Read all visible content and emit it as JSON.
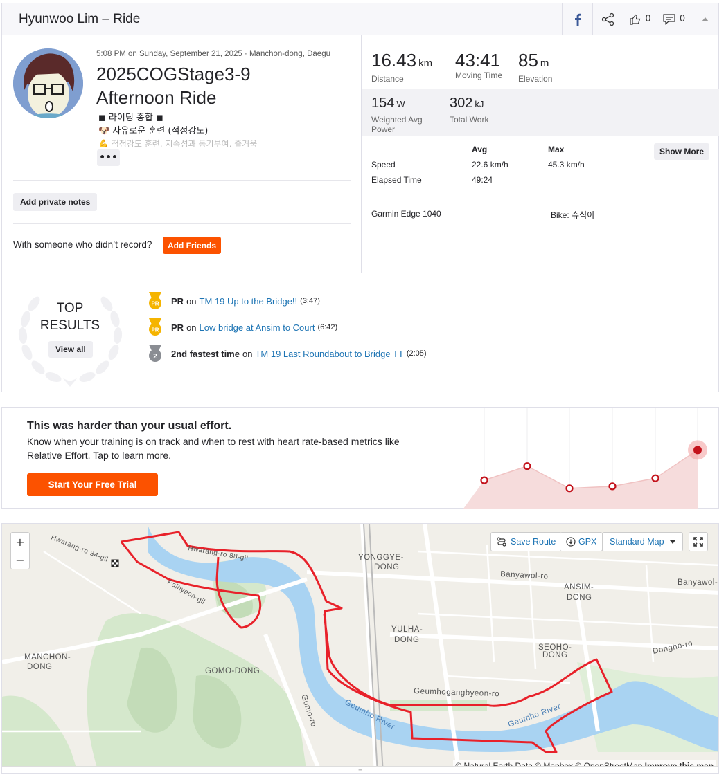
{
  "header": {
    "title": "Hyunwoo Lim – Ride",
    "kudos_count": "0",
    "comment_count": "0"
  },
  "activity": {
    "datetime_location": "5:08 PM on Sunday, September 21, 2025 · Manchon-dong, Daegu",
    "name_line1": "2025COGStage3-9",
    "name_line2": "Afternoon Ride",
    "description": [
      "◼ 라이딩 종합 ◼",
      "🐶 자유로운 훈련 (적정강도)",
      "💪 적정강도 훈련, 지속성과 동기부여, 즐거움"
    ],
    "more_label": "•••",
    "private_notes_label": "Add private notes",
    "with_someone_text": "With someone who didn’t record?",
    "add_friends_label": "Add Friends"
  },
  "stats": {
    "distance": {
      "value": "16.43",
      "unit": "km",
      "label": "Distance"
    },
    "moving_time": {
      "value": "43:41",
      "label": "Moving Time"
    },
    "elevation": {
      "value": "85",
      "unit": "m",
      "label": "Elevation"
    },
    "power": {
      "value": "154",
      "unit": "W",
      "label_1": "Weighted Avg",
      "label_2": "Power"
    },
    "work": {
      "value": "302",
      "unit": "kJ",
      "label": "Total Work"
    },
    "table": {
      "col_avg": "Avg",
      "col_max": "Max",
      "show_more": "Show More",
      "speed_label": "Speed",
      "speed_avg": "22.6 km/h",
      "speed_max": "45.3 km/h",
      "elapsed_label": "Elapsed Time",
      "elapsed_avg": "49:24"
    },
    "device": "Garmin Edge 1040",
    "bike_label": "Bike:",
    "bike_name": "슈식이"
  },
  "top_results": {
    "title_1": "TOP",
    "title_2": "RESULTS",
    "view_all": "View all",
    "items": [
      {
        "badge": "PR",
        "type": "PR",
        "on": "on",
        "segment": "TM 19 Up to the Bridge!!",
        "time": "(3:47)",
        "medal_color": "#f5b400"
      },
      {
        "badge": "PR",
        "type": "PR",
        "on": "on",
        "segment": "Low bridge at Ansim to Court",
        "time": "(6:42)",
        "medal_color": "#f5b400"
      },
      {
        "badge": "2",
        "type": "2nd fastest time",
        "on": "on",
        "segment": "TM 19 Last Roundabout to Bridge TT",
        "time": "(2:05)",
        "medal_color": "#8a8d93"
      }
    ]
  },
  "effort": {
    "title": "This was harder than your usual effort.",
    "body": "Know when your training is on track and when to rest with heart rate-based metrics like Relative Effort. Tap to learn more.",
    "cta": "Start Your Free Trial",
    "chart_points": [
      0.28,
      0.42,
      0.2,
      0.22,
      0.3,
      0.58
    ]
  },
  "map": {
    "zoom_in": "+",
    "zoom_out": "−",
    "save_route": "Save Route",
    "gpx": "GPX",
    "map_style": "Standard Map",
    "attribution_1": "© Natural Earth Data © Mapbox © OpenStreetMap",
    "attribution_2": "Improve this map",
    "labels": {
      "yonggye": "YONGGYE-",
      "yonggye2": "DONG",
      "banyawol": "Banyawol-ro",
      "ansim": "ANSIM-",
      "ansim2": "DONG",
      "yulha": "YULHA-",
      "yulha2": "DONG",
      "seoho": "SEOHO-",
      "seoho2": "DONG",
      "dongho": "Dongho-ro",
      "manchon": "MANCHON-",
      "manchon2": "DONG",
      "gomo": "GOMO-DONG",
      "gomoro": "Gomo-ro",
      "hwarang34": "Hwarang-ro 34-gil",
      "hwarang88": "Hwarang-ro 88-gil",
      "pallyeon": "Palhyeon-gil",
      "geumho_river1": "Geumho River",
      "geumho_river2": "Geumho River",
      "geumhogang": "Geumhogangbyeon-ro",
      "banyawol2": "Banyawol-ro"
    }
  }
}
